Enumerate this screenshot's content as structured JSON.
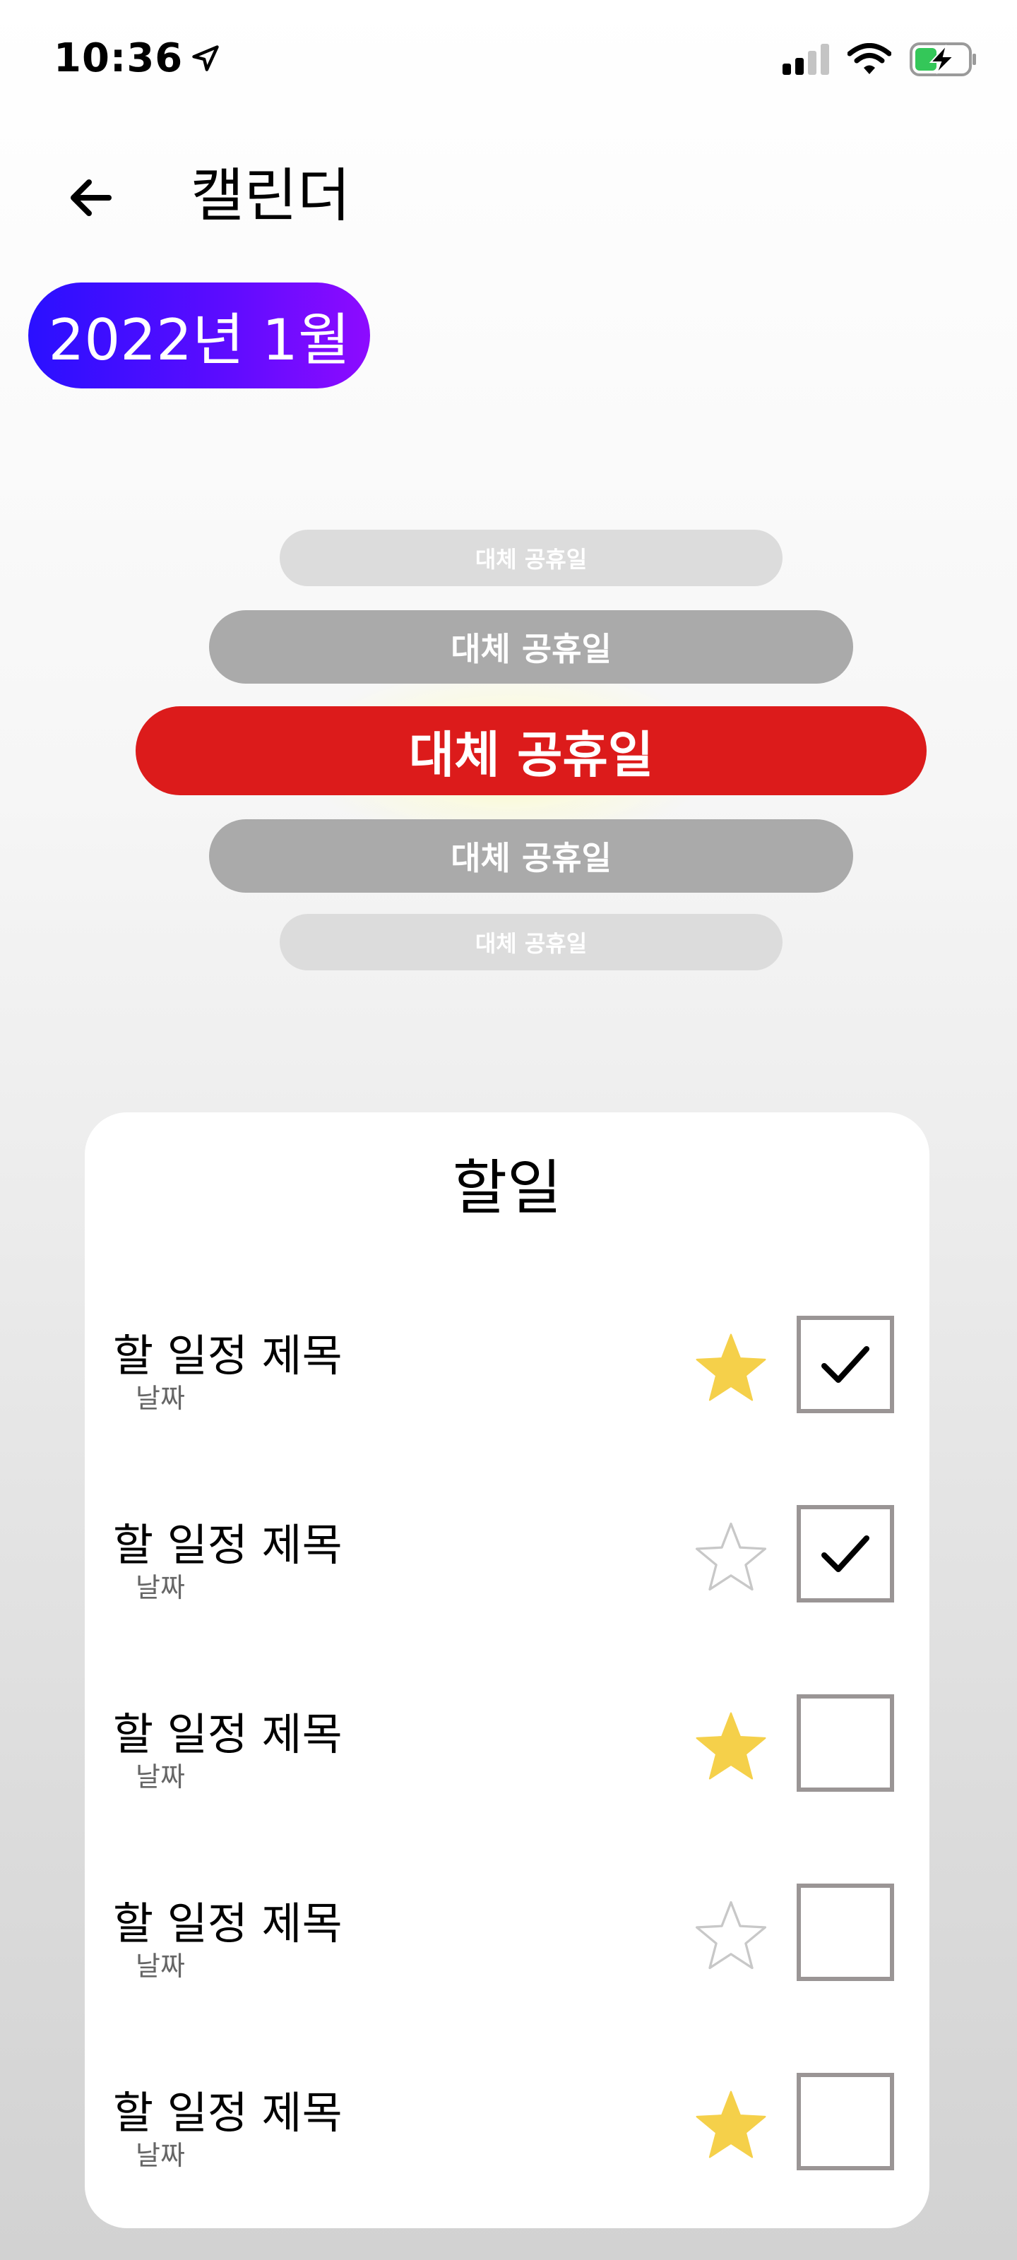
{
  "status_bar": {
    "time": "10:36",
    "location_icon": "location-arrow-icon",
    "signal_icon": "cellular-signal-icon",
    "wifi_icon": "wifi-icon",
    "battery_icon": "battery-charging-icon",
    "battery_color": "#34c759"
  },
  "header": {
    "back_icon": "arrow-left-icon",
    "title": "캘린더"
  },
  "month_selector": {
    "label": "2022년 1월",
    "gradient_start": "#2a10ff",
    "gradient_end": "#8d0bff"
  },
  "holiday_picker": {
    "items": [
      {
        "label": "대체 공휴일",
        "state": "far"
      },
      {
        "label": "대체 공휴일",
        "state": "near"
      },
      {
        "label": "대체 공휴일",
        "state": "selected"
      },
      {
        "label": "대체 공휴일",
        "state": "near"
      },
      {
        "label": "대체 공휴일",
        "state": "far"
      }
    ],
    "selected_color": "#dc1b1b",
    "near_color": "#aaaaaa",
    "far_color": "#dcdcdc"
  },
  "todo": {
    "title": "할일",
    "star_color": "#f5d04a",
    "items": [
      {
        "title": "할 일정 제목",
        "date": "날짜",
        "starred": true,
        "checked": true
      },
      {
        "title": "할 일정 제목",
        "date": "날짜",
        "starred": false,
        "checked": true
      },
      {
        "title": "할 일정 제목",
        "date": "날짜",
        "starred": true,
        "checked": false
      },
      {
        "title": "할 일정 제목",
        "date": "날짜",
        "starred": false,
        "checked": false
      },
      {
        "title": "할 일정 제목",
        "date": "날짜",
        "starred": true,
        "checked": false
      }
    ]
  }
}
